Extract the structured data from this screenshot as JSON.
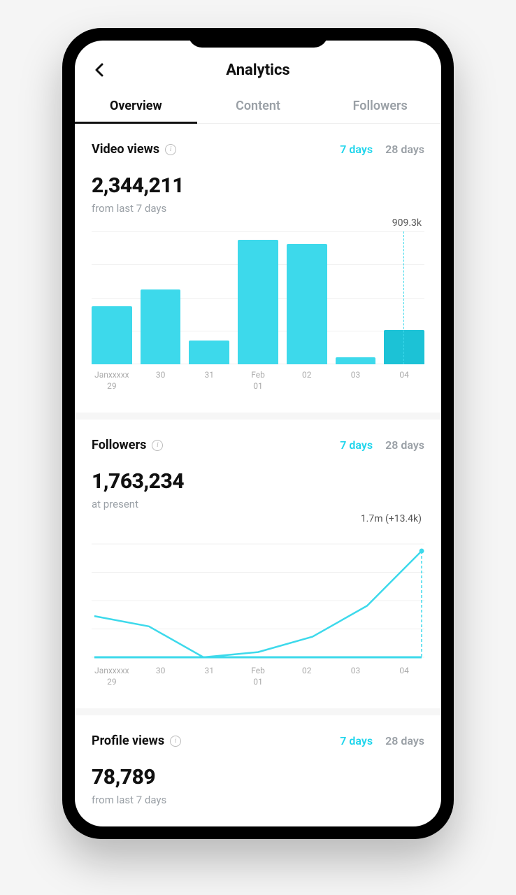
{
  "header": {
    "title": "Analytics"
  },
  "tabs": [
    {
      "label": "Overview",
      "active": true
    },
    {
      "label": "Content",
      "active": false
    },
    {
      "label": "Followers",
      "active": false
    }
  ],
  "range_options": {
    "opt7": "7 days",
    "opt28": "28 days"
  },
  "sections": {
    "video_views": {
      "title": "Video views",
      "value": "2,344,211",
      "sub": "from last 7 days",
      "annotation": "909.3k"
    },
    "followers": {
      "title": "Followers",
      "value": "1,763,234",
      "sub": "at present",
      "annotation": "1.7m (+13.4k)"
    },
    "profile_views": {
      "title": "Profile views",
      "value": "78,789",
      "sub": "from last 7 days"
    }
  },
  "chart_data": [
    {
      "type": "bar",
      "title": "Video views",
      "categories": [
        "Janxxxxx 29",
        "30",
        "31",
        "Feb 01",
        "02",
        "03",
        "04"
      ],
      "values": [
        420000,
        540000,
        170000,
        900000,
        870000,
        50000,
        250000
      ],
      "highlight_index": 6,
      "annotation": "909.3k",
      "ylim": [
        0,
        909300
      ]
    },
    {
      "type": "line",
      "title": "Followers",
      "categories": [
        "Janxxxxx 29",
        "30",
        "31",
        "Feb 01",
        "02",
        "03",
        "04"
      ],
      "x": [
        0,
        1,
        2,
        3,
        4,
        5,
        6
      ],
      "values": [
        1700000,
        1690000,
        1660000,
        1665000,
        1680000,
        1710000,
        1763234
      ],
      "annotation": "1.7m (+13.4k)",
      "ylim": [
        1660000,
        1770000
      ]
    }
  ]
}
